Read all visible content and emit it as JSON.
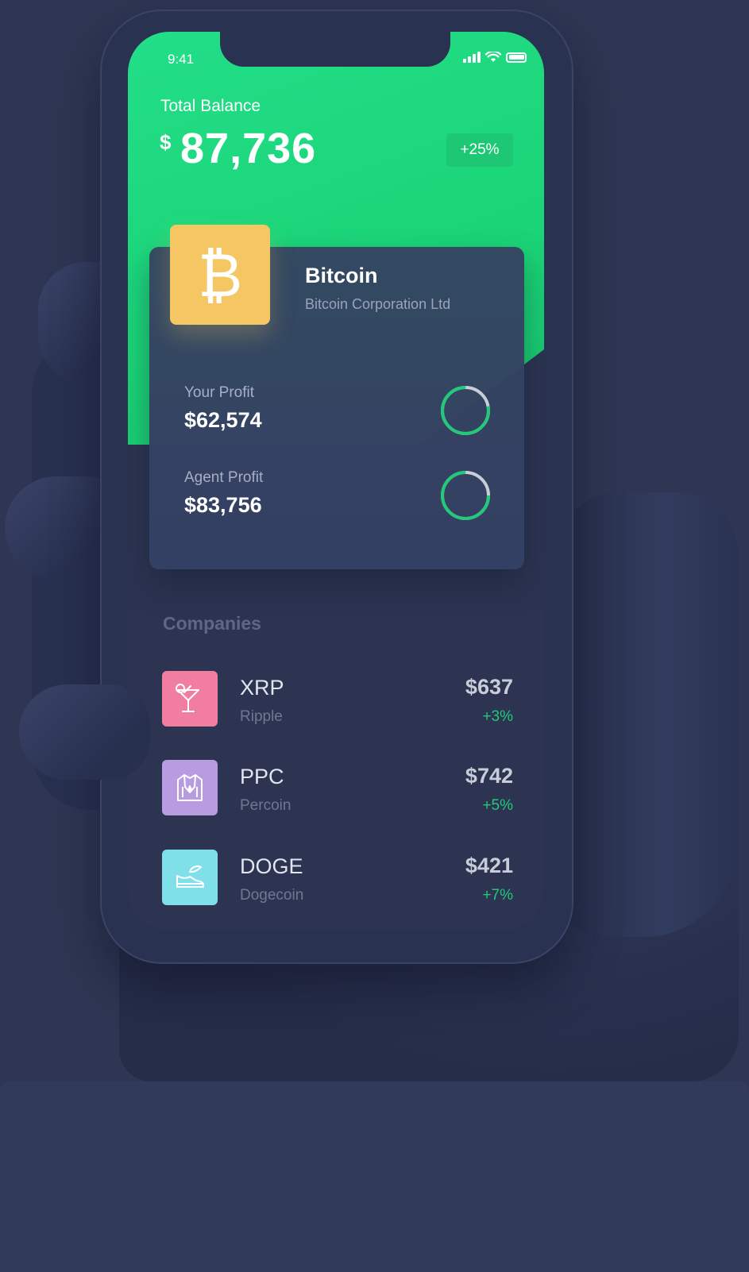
{
  "status_bar": {
    "time": "9:41"
  },
  "balance": {
    "label": "Total Balance",
    "currency_symbol": "$",
    "value": "87,736",
    "change": "+25%"
  },
  "coin_card": {
    "symbol": "₿",
    "name": "Bitcoin",
    "corporation": "Bitcoin Corporation Ltd",
    "profits": [
      {
        "label": "Your Profit",
        "value": "$62,574",
        "ring_fraction": 0.78
      },
      {
        "label": "Agent Profit",
        "value": "$83,756",
        "ring_fraction": 0.75
      }
    ]
  },
  "companies": {
    "title": "Companies",
    "items": [
      {
        "ticker": "XRP",
        "name": "Ripple",
        "price": "$637",
        "change": "+3%",
        "icon": "cocktail-icon",
        "color": "#f17ea0"
      },
      {
        "ticker": "PPC",
        "name": "Percoin",
        "price": "$742",
        "change": "+5%",
        "icon": "jacket-icon",
        "color": "#b89be0"
      },
      {
        "ticker": "DOGE",
        "name": "Dogecoin",
        "price": "$421",
        "change": "+7%",
        "icon": "sneaker-icon",
        "color": "#7fe0ea"
      }
    ]
  },
  "colors": {
    "accent_green": "#1fd67e",
    "background": "#2e3653",
    "coin_tile": "#f4c764"
  }
}
